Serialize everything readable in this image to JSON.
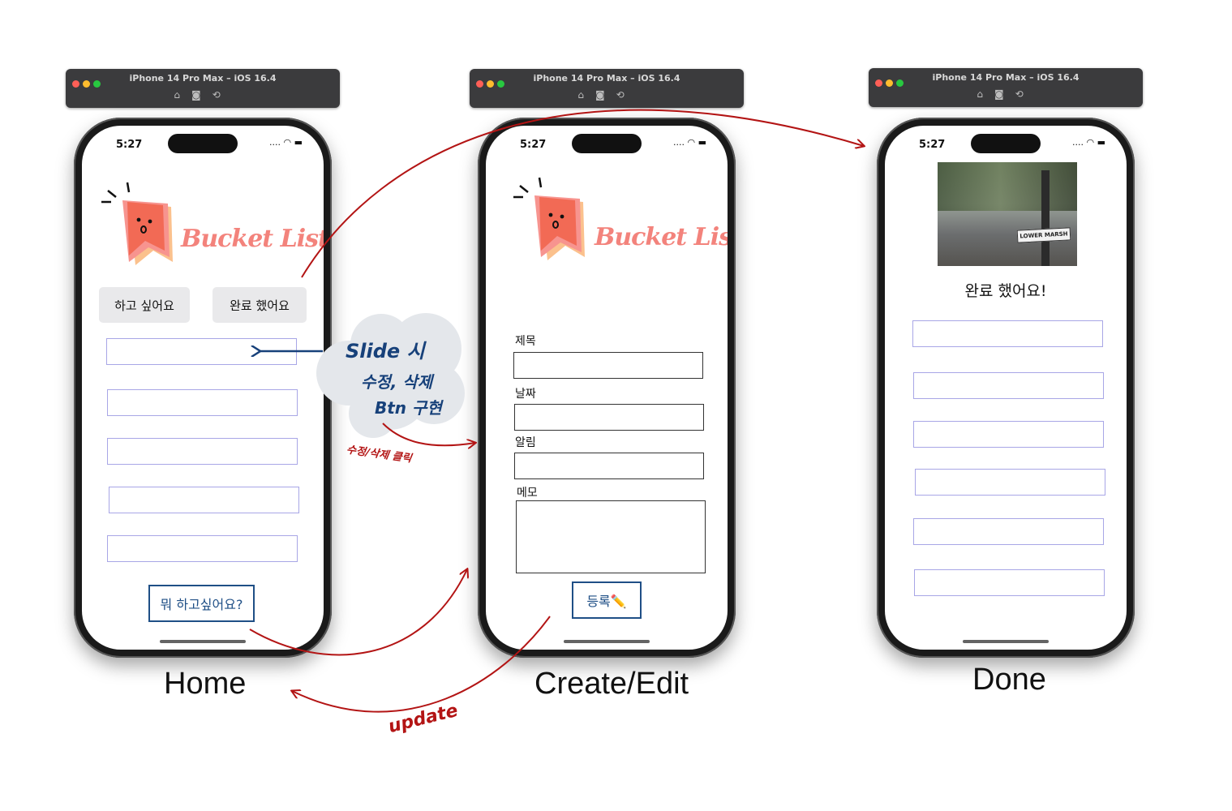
{
  "simulator": {
    "title": "iPhone 14 Pro Max – iOS 16.4",
    "icons": [
      "home-icon",
      "screenshot-icon",
      "rotate-icon"
    ]
  },
  "status_bar": {
    "time": "5:27",
    "signal": ".... ",
    "wifi": "◠",
    "battery": "▬"
  },
  "logo_text": "Bucket List!",
  "home": {
    "caption": "Home",
    "tab_want": "하고 싶어요",
    "tab_done": "완료 했어요",
    "add_button": "뭐 하고싶어요?",
    "row_count": 5
  },
  "edit": {
    "caption": "Create/Edit",
    "labels": {
      "title": "제목",
      "date": "날짜",
      "alarm": "알림",
      "memo": "메모"
    },
    "submit_button": "등록✏️"
  },
  "done": {
    "caption": "Done",
    "photo_sign": "LOWER MARSH",
    "subtitle": "완료 했어요!",
    "row_count": 6
  },
  "annotations": {
    "cloud_line1": "Slide 시",
    "cloud_line2": "수정, 삭제",
    "cloud_line3": "Btn 구현",
    "edit_delete_click": "수정/삭제 클릭",
    "update": "update"
  },
  "colors": {
    "arrow_red": "#b31414",
    "annotation_blue": "#17417a",
    "row_border": "#a8a6e6",
    "logo_pink": "#f3837c"
  }
}
